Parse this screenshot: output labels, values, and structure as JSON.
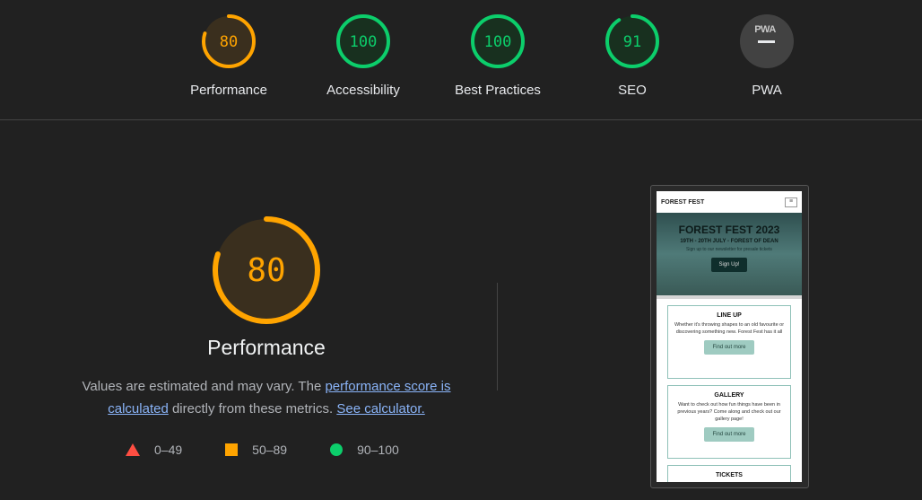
{
  "colors": {
    "good": "#0cce6b",
    "average": "#ffa400",
    "poor": "#ff4e42",
    "link": "#8ab4f8"
  },
  "categories": [
    {
      "label": "Performance",
      "score": "80",
      "value": 80,
      "color": "#ffa400"
    },
    {
      "label": "Accessibility",
      "score": "100",
      "value": 100,
      "color": "#0cce6b"
    },
    {
      "label": "Best Practices",
      "score": "100",
      "value": 100,
      "color": "#0cce6b"
    },
    {
      "label": "SEO",
      "score": "91",
      "value": 91,
      "color": "#0cce6b"
    },
    {
      "label": "PWA",
      "badge": "PWA"
    }
  ],
  "main": {
    "score": "80",
    "value": 80,
    "title": "Performance",
    "desc_part1": "Values are estimated and may vary. The ",
    "link1": "performance score is calculated",
    "desc_part2": " directly from these metrics. ",
    "link2": "See calculator."
  },
  "legend": [
    {
      "range": "0–49",
      "shape": "triangle"
    },
    {
      "range": "50–89",
      "shape": "square"
    },
    {
      "range": "90–100",
      "shape": "circle"
    }
  ],
  "screenshot": {
    "nav_brand": "FOREST FEST",
    "hero_title": "FOREST FEST 2023",
    "hero_sub": "19TH - 20TH JULY - FOREST OF DEAN",
    "hero_note": "Sign up to our newsletter for presale tickets",
    "hero_button": "Sign Up!",
    "cards": [
      {
        "title": "LINE UP",
        "text": "Whether it's throwing shapes to an old favourite or discovering something new. Forest Fest has it all",
        "button": "Find out more"
      },
      {
        "title": "GALLERY",
        "text": "Want to check out how fun things have been in previous years? Come along and check out our gallery page!",
        "button": "Find out more"
      },
      {
        "title": "TICKETS"
      }
    ]
  }
}
